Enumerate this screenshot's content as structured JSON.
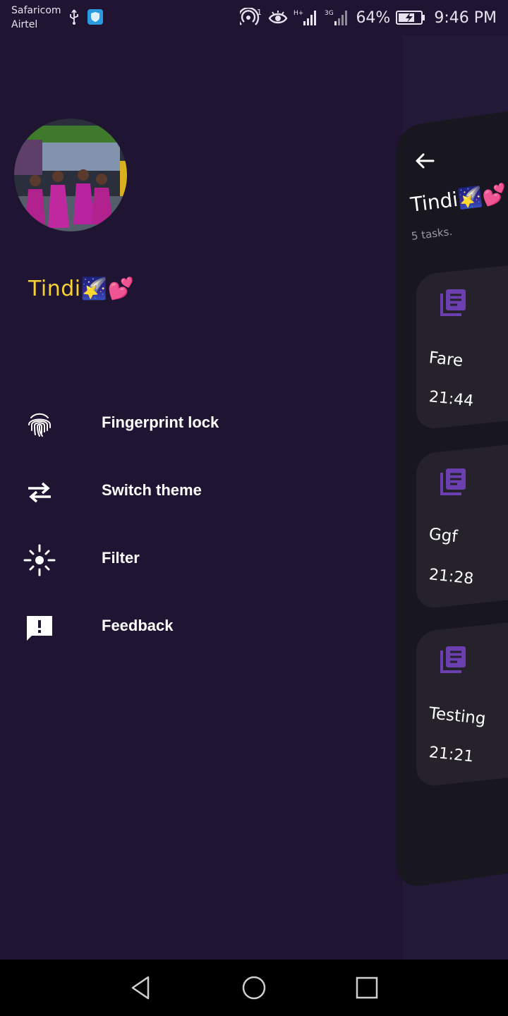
{
  "status_bar": {
    "carrier_1": "Safaricom",
    "carrier_2": "Airtel",
    "hotspot_badge": "1",
    "network_1": "H+",
    "network_2": "3G",
    "battery": "64%",
    "time": "9:46 PM"
  },
  "drawer": {
    "username": "Tindi🌠💕",
    "menu": [
      {
        "label": "Fingerprint lock",
        "icon": "fingerprint-icon"
      },
      {
        "label": "Switch theme",
        "icon": "swap-arrows-icon"
      },
      {
        "label": "Filter",
        "icon": "brightness-icon"
      },
      {
        "label": "Feedback",
        "icon": "feedback-icon"
      }
    ]
  },
  "home": {
    "title": "Tindi🌠💕",
    "subtitle": "5 tasks.",
    "tasks": [
      {
        "title": "Fare",
        "time": "21:44"
      },
      {
        "title": "Ggf",
        "time": "21:28"
      },
      {
        "title": "Testing",
        "time": "21:21"
      }
    ]
  },
  "colors": {
    "drawer_bg": "#1f1533",
    "accent_name": "#f6d135",
    "task_icon": "#6b3fb0",
    "card_bg": "#25222c"
  }
}
